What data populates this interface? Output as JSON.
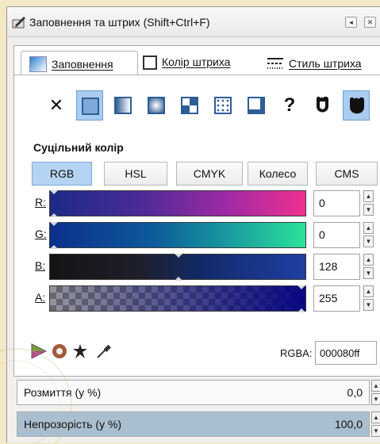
{
  "window": {
    "title": "Заповнення та штрих (Shift+Ctrl+F)",
    "buttons": [
      "◂",
      "✕"
    ]
  },
  "tabs": [
    {
      "label": "Заповнення",
      "icon": "fill-swatch-icon",
      "active": true
    },
    {
      "label": "Колір штриха",
      "icon": "stroke-paint-icon",
      "active": false
    },
    {
      "label": "Стиль штриха",
      "icon": "stroke-style-icon",
      "active": false
    }
  ],
  "fill_types": [
    {
      "name": "no-paint",
      "icon": "no-paint-icon",
      "symbol": "✕"
    },
    {
      "name": "flat-color",
      "icon": "flat-color-icon",
      "selected": true
    },
    {
      "name": "linear-gradient",
      "icon": "linear-gradient-icon"
    },
    {
      "name": "radial-gradient",
      "icon": "radial-gradient-icon"
    },
    {
      "name": "mesh-gradient",
      "icon": "mesh-gradient-icon"
    },
    {
      "name": "pattern",
      "icon": "pattern-icon"
    },
    {
      "name": "swatch",
      "icon": "swatch-icon"
    },
    {
      "name": "unset",
      "icon": "unset-paint-icon",
      "symbol": "?"
    },
    {
      "name": "fill-rule-evenodd",
      "icon": "fill-rule-evenodd-icon"
    },
    {
      "name": "fill-rule-nonzero",
      "icon": "fill-rule-nonzero-icon",
      "selected": true
    }
  ],
  "section_title": "Суцільний колір",
  "modes": [
    {
      "label": "RGB",
      "selected": true
    },
    {
      "label": "HSL"
    },
    {
      "label": "CMYK"
    },
    {
      "label": "Колесо"
    },
    {
      "label": "CMS"
    }
  ],
  "channels": [
    {
      "label": "R:",
      "value": "0",
      "level": 0.0
    },
    {
      "label": "G:",
      "value": "0",
      "level": 0.0
    },
    {
      "label": "B:",
      "value": "128",
      "level": 0.502
    },
    {
      "label": "A:",
      "value": "255",
      "level": 1.0
    }
  ],
  "rgba": {
    "label": "RGBA:",
    "value": "000080ff"
  },
  "blur": {
    "label": "Розмиття (у %)",
    "value": "0,0",
    "level": 0.0
  },
  "opacity": {
    "label": "Непрозорість (у %)",
    "value": "100,0",
    "level": 1.0
  },
  "tools": [
    "color-picker-tool-icon",
    "color-wheel-icon",
    "color-scale-icon",
    "eyedropper-icon"
  ],
  "colors": {
    "selected_fill": "#a9ccf0",
    "current_color": "#000080",
    "opacity_fill": "#a9bfd0"
  }
}
